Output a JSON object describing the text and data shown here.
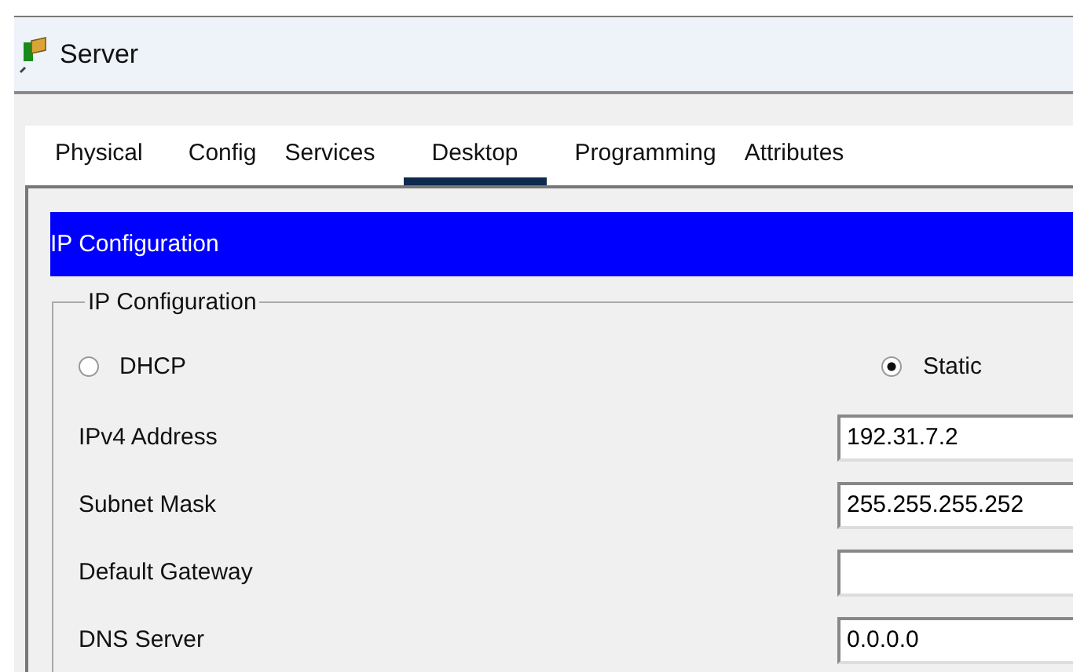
{
  "window": {
    "title": "Server"
  },
  "tabs": [
    {
      "label": "Physical",
      "selected": false
    },
    {
      "label": "Config",
      "selected": false
    },
    {
      "label": "Services",
      "selected": false
    },
    {
      "label": "Desktop",
      "selected": true
    },
    {
      "label": "Programming",
      "selected": false
    },
    {
      "label": "Attributes",
      "selected": false
    }
  ],
  "panel_header": "IP Configuration",
  "group": {
    "legend": "IP Configuration",
    "modes": [
      {
        "label": "DHCP",
        "selected": false
      },
      {
        "label": "Static",
        "selected": true
      }
    ],
    "fields": [
      {
        "label": "IPv4 Address",
        "value": "192.31.7.2"
      },
      {
        "label": "Subnet Mask",
        "value": "255.255.255.252"
      },
      {
        "label": "Default Gateway"
      },
      {
        "label": "DNS Server",
        "value": "0.0.0.0"
      }
    ]
  }
}
